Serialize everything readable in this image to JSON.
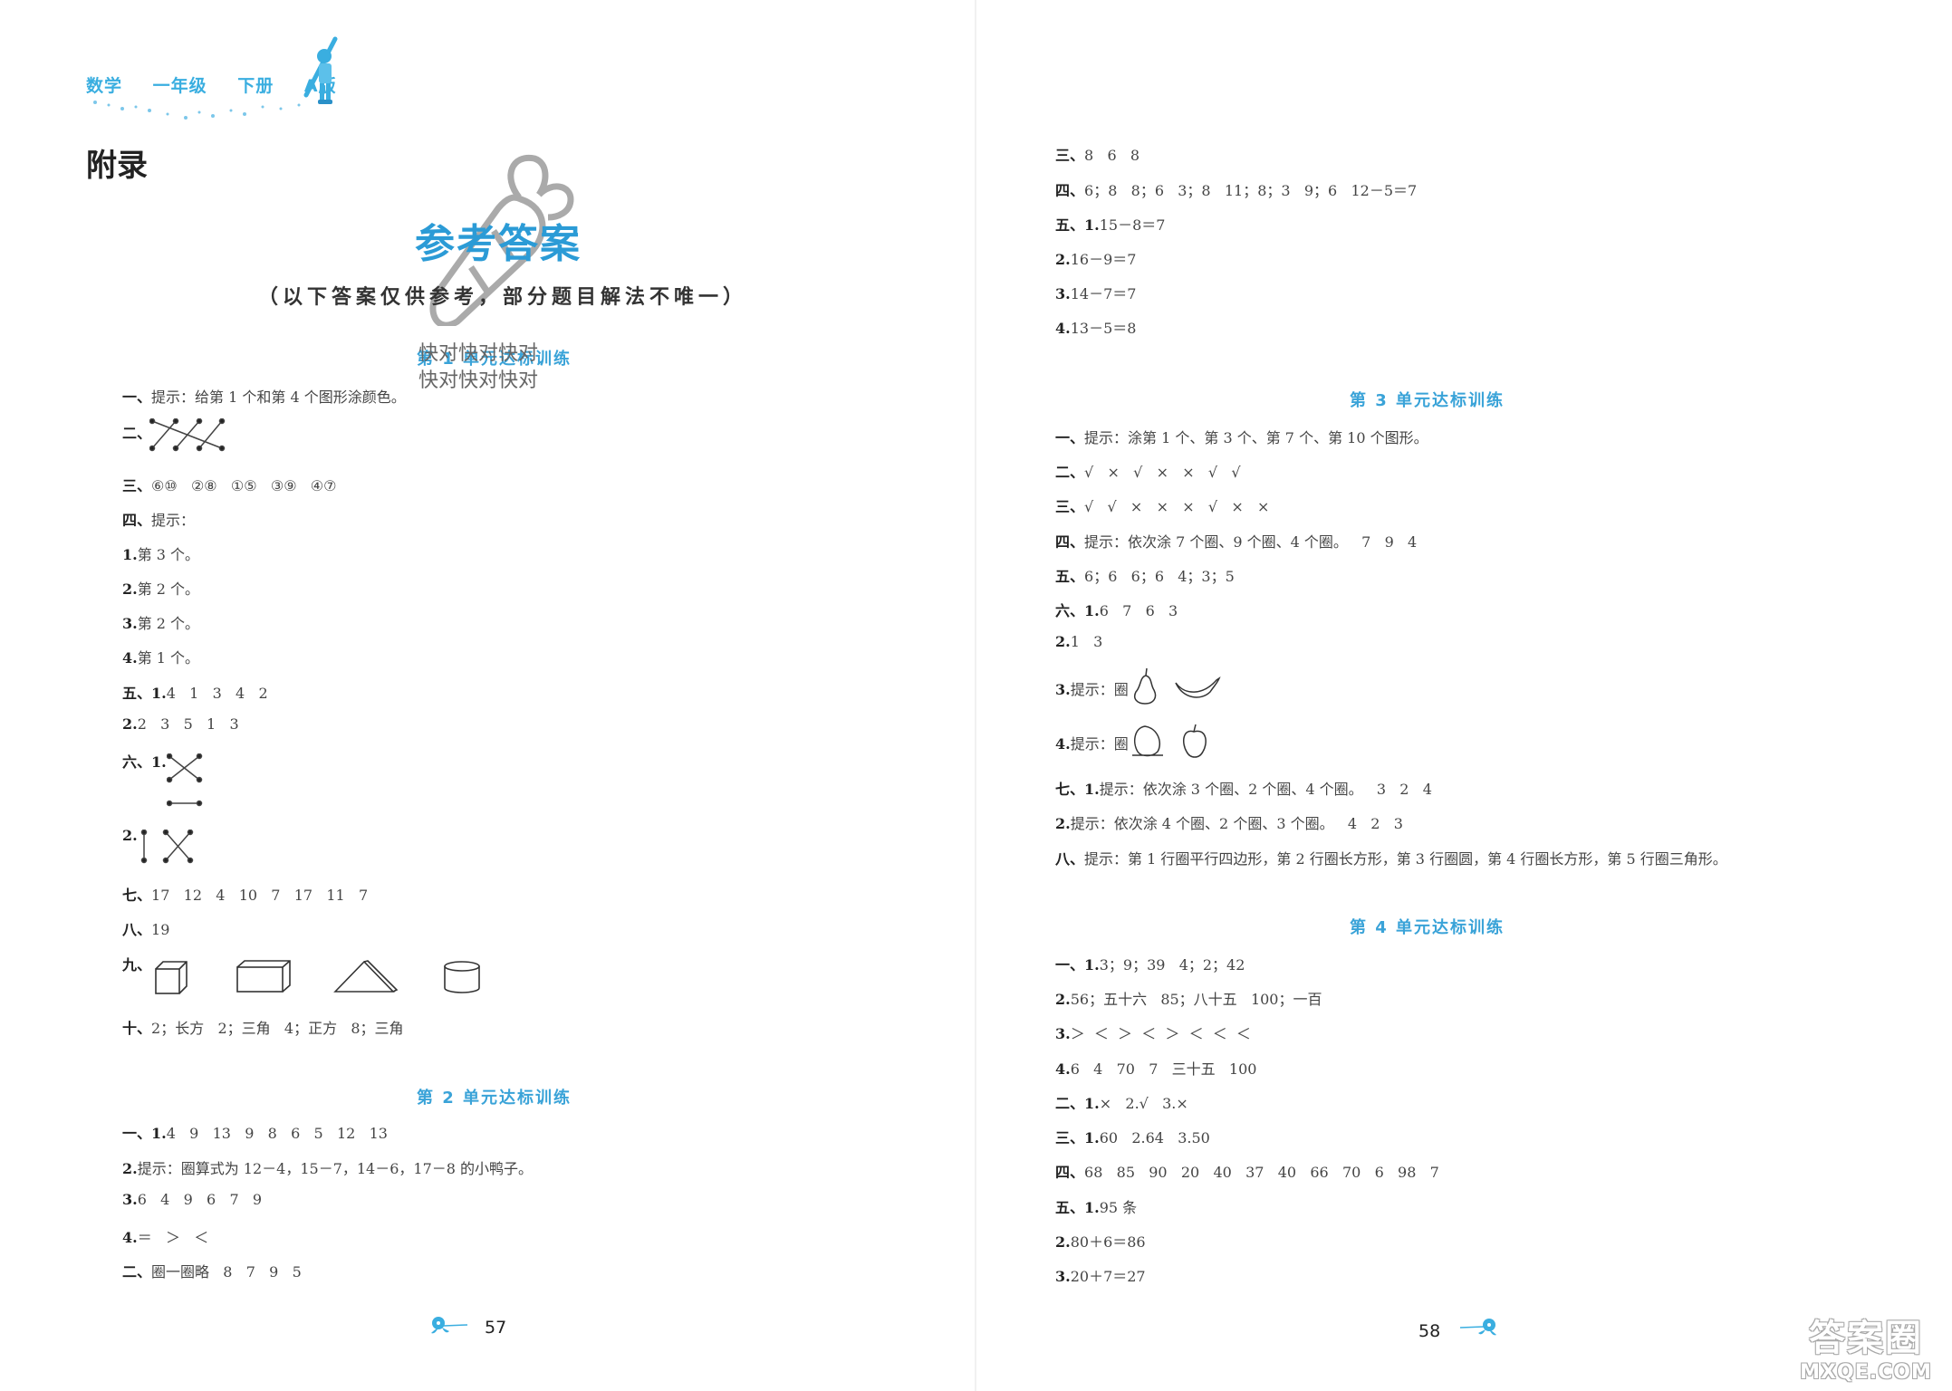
{
  "left_page": {
    "header": {
      "subject": "数学",
      "grade": "一年级",
      "volume": "下册",
      "edition": "A版"
    },
    "appendix_title": "附录",
    "main_title": "参考答案",
    "subtitle": "（以下答案仅供参考，部分题目解法不唯一）",
    "watermark_text": [
      "快对快对快对",
      "快对快对快对"
    ],
    "unit1": {
      "title": "第 1 单元达标训练",
      "lines": [
        {
          "label": "一、",
          "text": "提示：给第 1 个和第 4 个图形涂颜色。"
        },
        {
          "label": "二、",
          "text": ""
        },
        {
          "label": "三、",
          "text": "⑥⑩   ②⑧   ①⑤   ③⑨   ④⑦"
        },
        {
          "label": "四、",
          "text": "提示："
        },
        {
          "label": "1.",
          "text": "第 3 个。"
        },
        {
          "label": "2.",
          "text": "第 2 个。"
        },
        {
          "label": "3.",
          "text": "第 2 个。"
        },
        {
          "label": "4.",
          "text": "第 1 个。"
        },
        {
          "label": "五、1.",
          "text": "4   1   3   4   2"
        },
        {
          "label": "2.",
          "text": "2   3   5   1   3"
        },
        {
          "label": "六、1.",
          "text": ""
        },
        {
          "label": "2.",
          "text": ""
        },
        {
          "label": "七、",
          "text": "17   12   4   10   7   17   11   7"
        },
        {
          "label": "八、",
          "text": "19"
        },
        {
          "label": "九、",
          "text": ""
        },
        {
          "label": "十、",
          "text": "2；长方   2；三角   4；正方   8；三角"
        }
      ]
    },
    "unit2": {
      "title": "第 2 单元达标训练",
      "lines": [
        {
          "label": "一、1.",
          "text": "4   9   13   9   8   6   5   12   13"
        },
        {
          "label": "2.",
          "text": "提示：圈算式为 12－4，15－7，14－6，17－8 的小鸭子。"
        },
        {
          "label": "3.",
          "text": "6   4   9   6   7   9"
        },
        {
          "label": "4.",
          "text": "＝   ＞   ＜"
        },
        {
          "label": "二、",
          "text": "圈一圈略   8   7   9   5"
        }
      ]
    },
    "page_number": "57"
  },
  "right_page": {
    "unit2_cont": {
      "lines": [
        {
          "label": "三、",
          "text": "8   6   8"
        },
        {
          "label": "四、",
          "text": "6；8   8；6   3；8   11；8；3   9；6   12－5＝7"
        },
        {
          "label": "五、1.",
          "text": "15－8＝7"
        },
        {
          "label": "2.",
          "text": "16－9＝7"
        },
        {
          "label": "3.",
          "text": "14－7＝7"
        },
        {
          "label": "4.",
          "text": "13－5＝8"
        }
      ]
    },
    "unit3": {
      "title": "第 3 单元达标训练",
      "lines": [
        {
          "label": "一、",
          "text": "提示：涂第 1 个、第 3 个、第 7 个、第 10 个图形。"
        },
        {
          "label": "二、",
          "text": "√   ×   √   ×   ×   √   √"
        },
        {
          "label": "三、",
          "text": "√   √   ×   ×   ×   √   ×   ×"
        },
        {
          "label": "四、",
          "text": "提示：依次涂 7 个圈、9 个圈、4 个圈。   7   9   4"
        },
        {
          "label": "五、",
          "text": "6；6   6；6   4；3；5"
        },
        {
          "label": "六、1.",
          "text": "6   7   6   3"
        },
        {
          "label": "2.",
          "text": "1   3"
        },
        {
          "label": "3.",
          "text": "提示：圈"
        },
        {
          "label": "4.",
          "text": "提示：圈"
        },
        {
          "label": "七、1.",
          "text": "提示：依次涂 3 个圈、2 个圈、4 个圈。   3   2   4"
        },
        {
          "label": "2.",
          "text": "提示：依次涂 4 个圈、2 个圈、3 个圈。   4   2   3"
        },
        {
          "label": "八、",
          "text": "提示：第 1 行圈平行四边形，第 2 行圈长方形，第 3 行圈圆，第 4 行圈长方形，第 5 行圈三角形。"
        }
      ],
      "fruit_icons": [
        "pear",
        "banana",
        "peach",
        "apple"
      ]
    },
    "unit4": {
      "title": "第 4 单元达标训练",
      "lines": [
        {
          "label": "一、1.",
          "text": "3；9；39   4；2；42"
        },
        {
          "label": "2.",
          "text": "56；五十六   85；八十五   100；一百"
        },
        {
          "label": "3.",
          "text": "＞  ＜  ＞  ＜  ＞  ＜  ＜  ＜"
        },
        {
          "label": "4.",
          "text": "6   4   70   7   三十五   100"
        },
        {
          "label": "二、1.",
          "text": "×   2.√   3.×"
        },
        {
          "label": "三、1.",
          "text": "60   2.64   3.50"
        },
        {
          "label": "四、",
          "text": "68   85   90   20   40   37   40   66   70   6   98   7"
        },
        {
          "label": "五、1.",
          "text": "95 条"
        },
        {
          "label": "2.",
          "text": "80＋6＝86"
        },
        {
          "label": "3.",
          "text": "20＋7＝27"
        }
      ]
    },
    "page_number": "58"
  },
  "site_watermark": {
    "top": "答案圈",
    "bottom": "MXQE.COM"
  },
  "colors": {
    "accent_blue": "#3aa3d8",
    "title_blue": "#2b9bd6",
    "text": "#333333"
  }
}
